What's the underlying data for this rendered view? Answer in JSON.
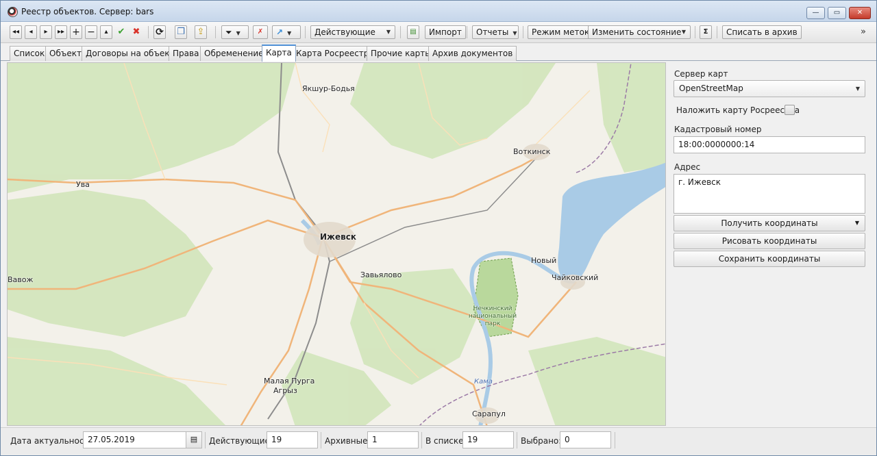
{
  "window": {
    "title": "Реестр объектов. Сервер: bars",
    "controls": {
      "minimize": "—",
      "maximize": "▭",
      "close": "✕"
    }
  },
  "toolbar": {
    "nav_icons": [
      "first-icon",
      "prev-icon",
      "next-icon",
      "last-icon",
      "add-icon",
      "remove-icon",
      "up-icon",
      "apply-icon",
      "delete-icon",
      "refresh-icon",
      "copy-icon",
      "export-icon",
      "filter-icon",
      "clear-filter-icon",
      "goto-icon",
      "sum-icon"
    ],
    "glyphs": {
      "first": "◂◂",
      "prev": "◂",
      "next": "▸",
      "last": "▸▸",
      "add": "+",
      "remove": "−",
      "up": "▴",
      "apply": "✔",
      "delete": "✖",
      "refresh": "⟳",
      "copy": "❐",
      "export": "⇪",
      "filter": "⏷",
      "clear_filter": "✗",
      "goto": "↗",
      "print": "▤",
      "sum": "Σ",
      "more": "»",
      "dropdown": "▼"
    },
    "status_filter": "Действующие",
    "import_label": "Импорт",
    "reports_label": "Отчеты",
    "marks_mode_label": "Режим меток",
    "change_state_label": "Изменить состояние",
    "archive_label": "Списать в архив",
    "colors": {
      "apply": "#3aa12f",
      "delete": "#d9332a",
      "goto": "#3a8ed8"
    }
  },
  "tabs": [
    {
      "label": "Список",
      "active": false
    },
    {
      "label": "Объект",
      "active": false
    },
    {
      "label": "Договоры на объект",
      "active": false
    },
    {
      "label": "Права",
      "active": false
    },
    {
      "label": "Обременение",
      "active": false
    },
    {
      "label": "Карта",
      "active": true
    },
    {
      "label": "Карта Росреестра",
      "active": false
    },
    {
      "label": "Прочие карты",
      "active": false
    },
    {
      "label": "Архив документов",
      "active": false
    }
  ],
  "map": {
    "labels": {
      "yakshur": "Якшур-Бодья",
      "votkinsk": "Воткинск",
      "uva": "Ува",
      "izhevsk": "Ижевск",
      "novy": "Новый",
      "vavozh": "Вавож",
      "zavyalovo": "Завьялово",
      "chaikovsky": "Чайковский",
      "park": "Нечкинский национальный парк",
      "kama": "Кама",
      "malaya_purga": "Малая Пурга",
      "agryz": "Агрыз",
      "sarapul": "Сарапул"
    },
    "colors": {
      "land": "#f3f1ea",
      "forest": "#cfe3b6",
      "water": "#a9cbe6",
      "road_major": "#f0b57a",
      "road_minor": "#ffffff",
      "rail": "#8c8c8c",
      "border": "#9b7aa6"
    }
  },
  "panel": {
    "map_server_label": "Сервер карт",
    "map_server_value": "OpenStreetMap",
    "overlay_label": "Наложить карту Росреестра",
    "overlay_checked": false,
    "cadastral_label": "Кадастровый номер",
    "cadastral_value": "18:00:0000000:14",
    "address_label": "Адрес",
    "address_value": "г. Ижевск",
    "get_coords_label": "Получить координаты",
    "draw_coords_label": "Рисовать координаты",
    "save_coords_label": "Сохранить координаты"
  },
  "statusbar": {
    "date_label": "Дата актуальности",
    "date_value": "27.05.2019",
    "active_label": "Действующие:",
    "active_value": "19",
    "archived_label": "Архивные:",
    "archived_value": "1",
    "in_list_label": "В списке:",
    "in_list_value": "19",
    "selected_label": "Выбрано:",
    "selected_value": "0"
  }
}
